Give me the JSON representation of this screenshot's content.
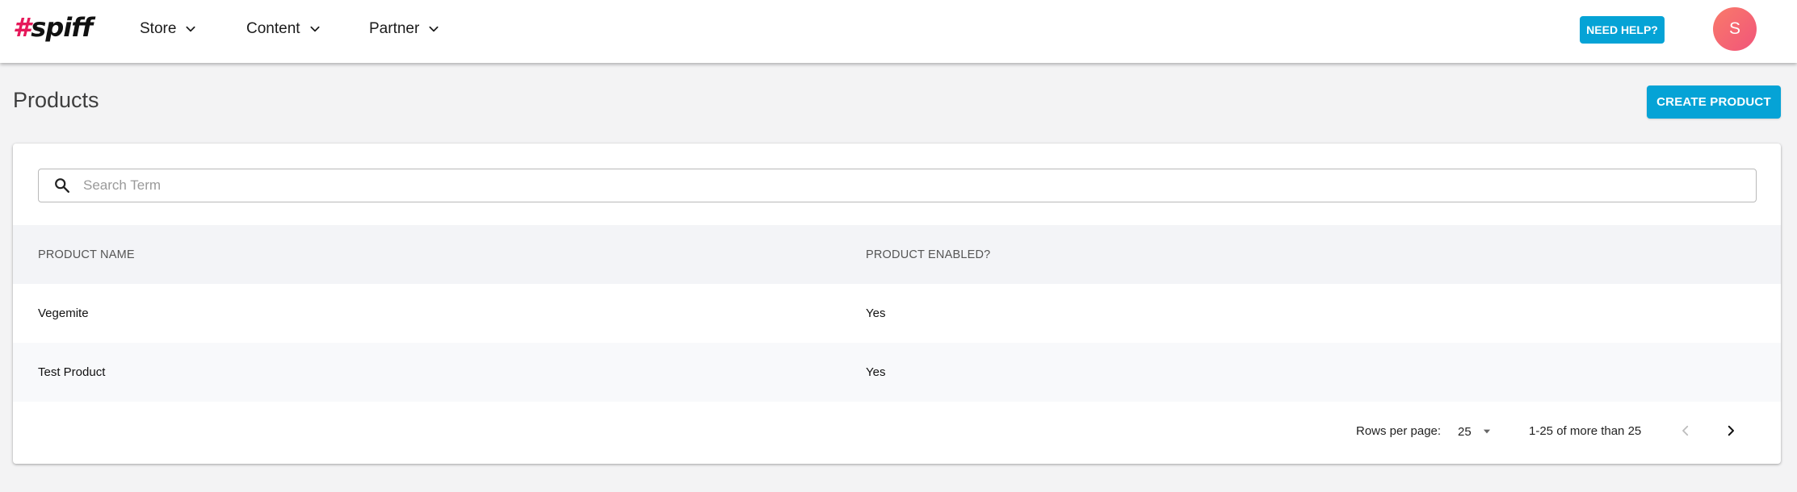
{
  "brand": {
    "hash": "#",
    "name": "spiff",
    "hash_color": "#e6195a"
  },
  "nav": {
    "items": [
      {
        "label": "Store",
        "icon": "chevron-down-icon"
      },
      {
        "label": "Content",
        "icon": "chevron-down-icon"
      },
      {
        "label": "Partner",
        "icon": "chevron-down-icon"
      }
    ]
  },
  "header": {
    "help_label": "NEED HELP?",
    "avatar_initial": "S"
  },
  "page": {
    "title": "Products",
    "create_label": "CREATE PRODUCT"
  },
  "search": {
    "placeholder": "Search Term",
    "value": "",
    "icon": "search-icon"
  },
  "table": {
    "columns": [
      "PRODUCT NAME",
      "PRODUCT ENABLED?"
    ],
    "rows": [
      [
        "Vegemite",
        "Yes"
      ],
      [
        "Test Product",
        "Yes"
      ]
    ]
  },
  "pagination": {
    "rows_per_page_label": "Rows per page:",
    "rows_per_page_value": "25",
    "range_text": "1-25 of more than 25",
    "prev_icon": "chevron-left-icon",
    "next_icon": "chevron-right-icon"
  },
  "colors": {
    "accent": "#05a3d6",
    "avatar_gradient_start": "#f97a6a",
    "avatar_gradient_end": "#f1557a",
    "background": "#f3f3f4"
  }
}
